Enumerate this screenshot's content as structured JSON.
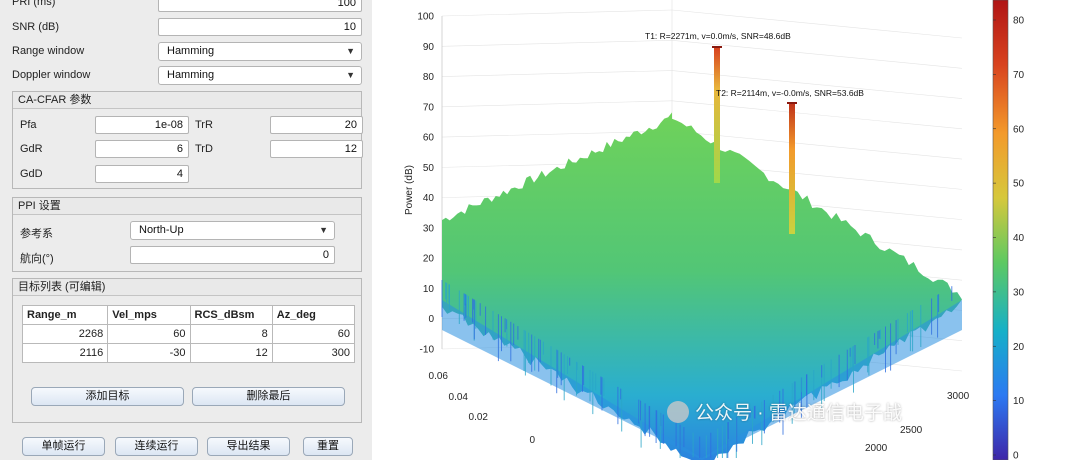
{
  "params": {
    "pri": {
      "label": "PRI (ms)",
      "value": "100"
    },
    "snr": {
      "label": "SNR (dB)",
      "value": "10"
    },
    "range_window": {
      "label": "Range window",
      "value": "Hamming"
    },
    "doppler_window": {
      "label": "Doppler window",
      "value": "Hamming"
    }
  },
  "cfar": {
    "title": "CA-CFAR 参数",
    "pfa": {
      "label": "Pfa",
      "value": "1e-08"
    },
    "trr": {
      "label": "TrR",
      "value": "20"
    },
    "gdr": {
      "label": "GdR",
      "value": "6"
    },
    "trd": {
      "label": "TrD",
      "value": "12"
    },
    "gdd": {
      "label": "GdD",
      "value": "4"
    }
  },
  "ppi": {
    "title": "PPI 设置",
    "ref": {
      "label": "参考系",
      "value": "North-Up"
    },
    "heading": {
      "label": "航向(°)",
      "value": "0"
    }
  },
  "targets": {
    "title": "目标列表 (可编辑)",
    "columns": [
      "Range_m",
      "Vel_mps",
      "RCS_dBsm",
      "Az_deg"
    ],
    "rows": [
      [
        "2268",
        "60",
        "8",
        "60"
      ],
      [
        "2116",
        "-30",
        "12",
        "300"
      ]
    ],
    "add_label": "添加目标",
    "remove_label": "删除最后"
  },
  "actions": {
    "single": "单帧运行",
    "continuous": "连续运行",
    "export": "导出结果",
    "reset": "重置"
  },
  "chart_data": {
    "type": "surface",
    "zlabel": "Power (dB)",
    "z_ticks": [
      100,
      90,
      80,
      70,
      60,
      50,
      40,
      30,
      20,
      10,
      0,
      -10
    ],
    "velocity_ticks": [
      "0",
      "0.02",
      "0.04",
      "0.06"
    ],
    "range_ticks": [
      "2000",
      "2500",
      "3000"
    ],
    "colorbar_ticks": [
      80,
      70,
      60,
      50,
      40,
      30,
      20,
      10,
      0
    ],
    "colormap": [
      "#3e26a8",
      "#2c79f2",
      "#16b0c8",
      "#5ec962",
      "#d6c83c",
      "#f39a2b",
      "#d8431f",
      "#b01515"
    ],
    "noise_floor_db": [
      20,
      40
    ],
    "peaks": [
      {
        "label": "T1: R=2271m, v=0.0m/s, SNR=48.6dB",
        "power_db": 89
      },
      {
        "label": "T2: R=2114m, v=-0.0m/s, SNR=53.6dB",
        "power_db": 72
      }
    ]
  },
  "watermark": "公众号 · 雷达通信电子战"
}
